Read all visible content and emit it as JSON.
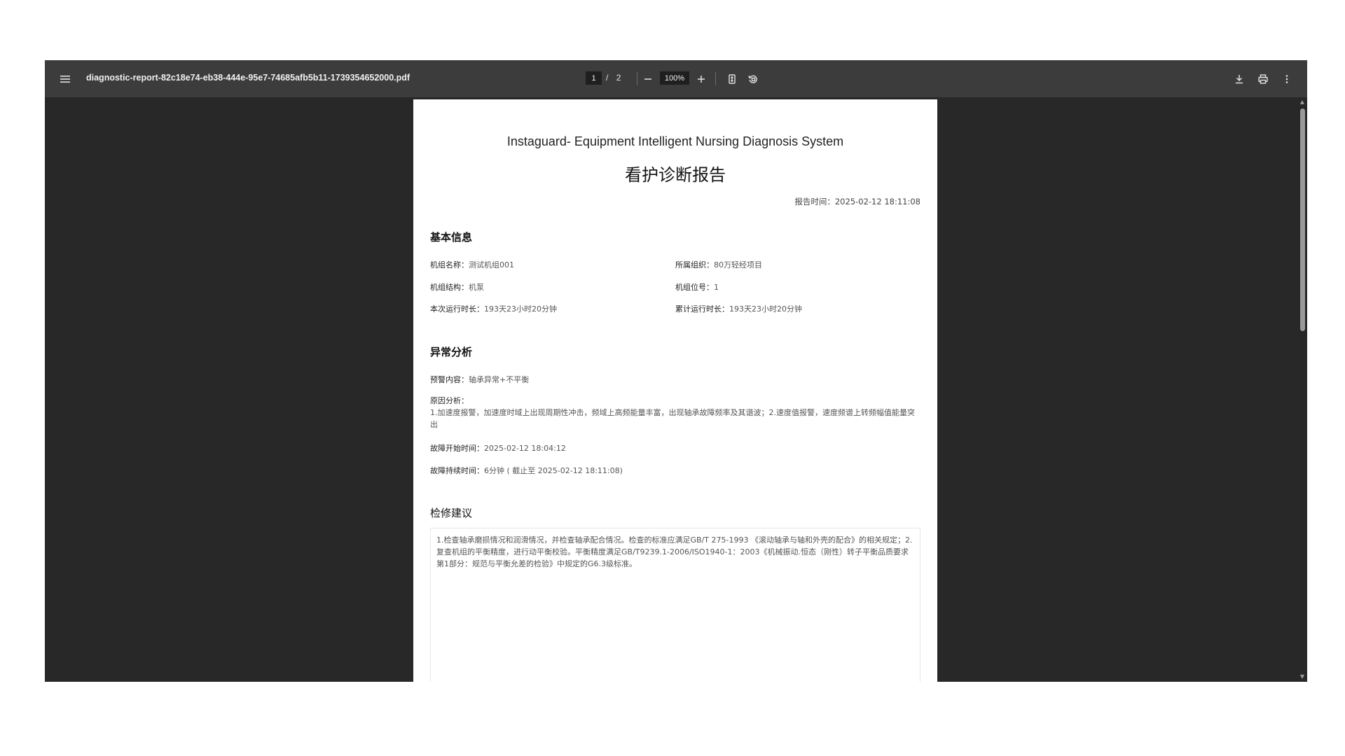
{
  "toolbar": {
    "file_name": "diagnostic-report-82c18e74-eb38-444e-95e7-74685afb5b11-1739354652000.pdf",
    "current_page": "1",
    "page_separator": "/",
    "total_pages": "2",
    "zoom": "100%",
    "icons": {
      "menu": "menu-icon",
      "zoom_out": "minus-icon",
      "zoom_in": "plus-icon",
      "fit": "fit-page-icon",
      "rotate": "rotate-icon",
      "download": "download-icon",
      "print": "print-icon",
      "more": "more-vert-icon"
    }
  },
  "document": {
    "system_title": "Instaguard- Equipment Intelligent Nursing Diagnosis System",
    "report_title": "看护诊断报告",
    "report_time": "报告时间：2025-02-12 18:11:08",
    "basic_info": {
      "heading": "基本信息",
      "unit_name_label": "机组名称：",
      "unit_name_value": "测试机组001",
      "organization_label": "所属组织：",
      "organization_value": "80万轻经项目",
      "structure_label": "机组结构：",
      "structure_value": "机泵",
      "position_label": "机组位号：",
      "position_value": "1",
      "current_runtime_label": "本次运行时长：",
      "current_runtime_value": "193天23小时20分钟",
      "total_runtime_label": "累计运行时长：",
      "total_runtime_value": "193天23小时20分钟"
    },
    "anomaly": {
      "heading": "异常分析",
      "warning_label": "预警内容：",
      "warning_value": "轴承异常+不平衡",
      "reason_label": "原因分析：",
      "reason_value": "1.加速度报警，加速度时域上出现周期性冲击，频域上高频能量丰富，出现轴承故障频率及其谐波；2.速度值报警，速度频谱上转频幅值能量突出",
      "fault_start_label": "故障开始时间：",
      "fault_start_value": "2025-02-12 18:04:12",
      "fault_duration_label": "故障持续时间：",
      "fault_duration_value": "6分钟 ( 截止至 2025-02-12 18:11:08)"
    },
    "maintenance": {
      "heading": "检修建议",
      "text": "1.检查轴承磨损情况和润滑情况，并检查轴承配合情况。检查的标准应满足GB/T 275-1993 《滚动轴承与轴和外壳的配合》的相关规定；2.复查机组的平衡精度，进行动平衡校验。平衡精度满足GB/T9239.1-2006/ISO1940-1：2003《机械振动.恒态（刚性）转子平衡品质要求第1部分：规范与平衡允差的检验》中规定的G6.3级标准。"
    }
  },
  "colors": {
    "toolbar_bg": "#3c3c3c",
    "viewer_bg": "#282828",
    "page_bg": "#ffffff"
  }
}
